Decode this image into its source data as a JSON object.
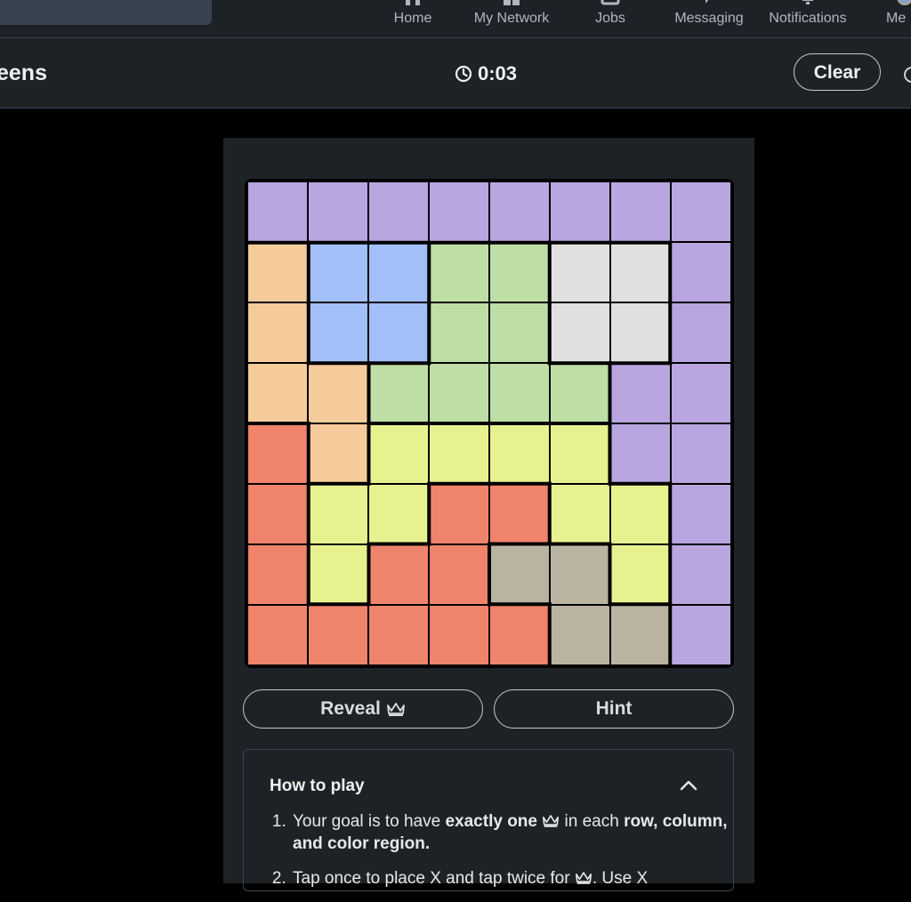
{
  "nav": {
    "items": [
      {
        "label": "Home",
        "icon": "home-icon"
      },
      {
        "label": "My Network",
        "icon": "network-icon"
      },
      {
        "label": "Jobs",
        "icon": "jobs-icon"
      },
      {
        "label": "Messaging",
        "icon": "messaging-icon"
      },
      {
        "label": "Notifications",
        "icon": "bell-icon"
      },
      {
        "label": "Me",
        "icon": "avatar"
      }
    ]
  },
  "game": {
    "title": "eens",
    "timer": "0:03",
    "clear_label": "Clear"
  },
  "board": {
    "size": 8,
    "colors": {
      "P": "#b9a6e0",
      "O": "#f6cb9c",
      "B": "#a3bffa",
      "G": "#bfdea6",
      "W": "#e0e0e0",
      "Y": "#e8f18f",
      "R": "#ef836c",
      "T": "#bab3a1"
    },
    "rows": [
      "PPPPPPPP",
      "OBBGGWWP",
      "OBBGGWWP",
      "OOGGGGPP",
      "ROYYYYPP",
      "RYYRRYYP",
      "RYRRTTYP",
      "RRRRRTTP"
    ]
  },
  "actions": {
    "reveal_label": "Reveal",
    "hint_label": "Hint"
  },
  "howto": {
    "title": "How to play",
    "step1": {
      "a": "Your goal is to have ",
      "b": "exactly one",
      "c": " in each ",
      "d": "row, column, and color region."
    },
    "step2": {
      "a": "Tap once to place X and tap twice for",
      "b": ". Use X"
    }
  }
}
